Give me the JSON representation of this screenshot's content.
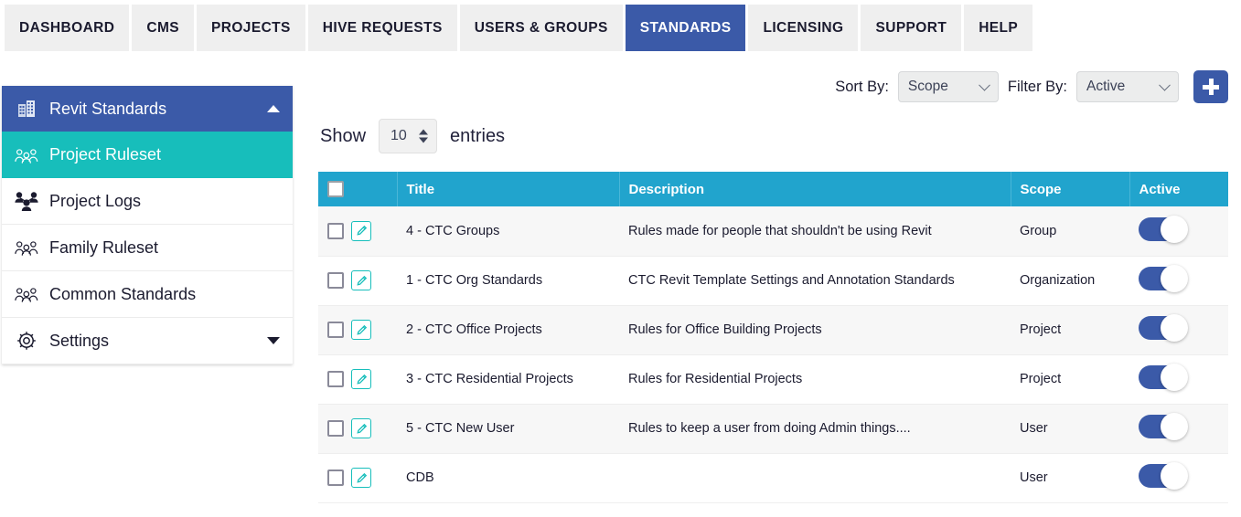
{
  "nav": {
    "tabs": [
      {
        "label": "DASHBOARD",
        "active": false
      },
      {
        "label": "CMS",
        "active": false
      },
      {
        "label": "PROJECTS",
        "active": false
      },
      {
        "label": "HIVE REQUESTS",
        "active": false
      },
      {
        "label": "USERS & GROUPS",
        "active": false
      },
      {
        "label": "STANDARDS",
        "active": true
      },
      {
        "label": "LICENSING",
        "active": false
      },
      {
        "label": "SUPPORT",
        "active": false
      },
      {
        "label": "HELP",
        "active": false
      }
    ]
  },
  "sidebar": {
    "header": {
      "label": "Revit Standards",
      "icon": "building-icon",
      "caret": "chevron-up-icon"
    },
    "items": [
      {
        "label": "Project Ruleset",
        "icon": "people-outline-icon",
        "selected": true
      },
      {
        "label": "Project Logs",
        "icon": "people-filled-icon",
        "selected": false
      },
      {
        "label": "Family Ruleset",
        "icon": "people-outline-icon",
        "selected": false
      },
      {
        "label": "Common Standards",
        "icon": "people-outline-icon",
        "selected": false
      },
      {
        "label": "Settings",
        "icon": "gear-icon",
        "selected": false,
        "caret": "chevron-down-icon"
      }
    ]
  },
  "toolbar": {
    "sort_by_label": "Sort By:",
    "sort_by_value": "Scope",
    "filter_by_label": "Filter By:",
    "filter_by_value": "Active",
    "add_button_icon": "plus-icon"
  },
  "show_entries": {
    "prefix": "Show",
    "value": "10",
    "suffix": "entries"
  },
  "table": {
    "columns": [
      "",
      "Title",
      "Description",
      "Scope",
      "Active"
    ],
    "rows": [
      {
        "title": "4 - CTC Groups",
        "description": "Rules made for people that shouldn't be using Revit",
        "scope": "Group",
        "active": true
      },
      {
        "title": "1 - CTC Org Standards",
        "description": "CTC Revit Template Settings and Annotation Standards",
        "scope": "Organization",
        "active": true
      },
      {
        "title": "2 - CTC Office Projects",
        "description": "Rules for Office Building Projects",
        "scope": "Project",
        "active": true
      },
      {
        "title": "3 - CTC Residential Projects",
        "description": "Rules for Residential Projects",
        "scope": "Project",
        "active": true
      },
      {
        "title": "5 - CTC New User",
        "description": "Rules to keep a user from doing Admin things....",
        "scope": "User",
        "active": true
      },
      {
        "title": "CDB",
        "description": "",
        "scope": "User",
        "active": true
      }
    ]
  },
  "colors": {
    "nav_active": "#3b5aa8",
    "sidebar_selected": "#17bebb",
    "table_header": "#21a4cd",
    "toggle_on": "#3b5aa8",
    "edit_icon": "#17bebb"
  }
}
